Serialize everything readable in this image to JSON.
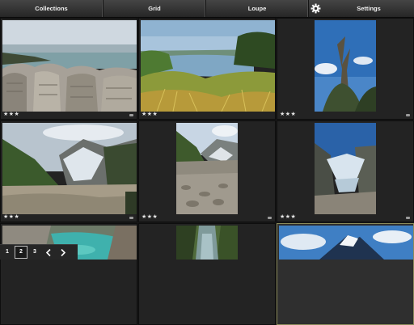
{
  "nav": {
    "collections": "Collections",
    "grid": "Grid",
    "loupe": "Loupe",
    "settings": "Settings",
    "settings_icon": "gear-icon"
  },
  "photos": [
    {
      "rating": "★★★",
      "subject": "limestone pancake rocks by the sea"
    },
    {
      "rating": "★★★",
      "subject": "lagoon with tussock grass"
    },
    {
      "rating": "★★★",
      "subject": "dead tree against blue sky"
    },
    {
      "rating": "★★★",
      "subject": "glacier valley with river bed"
    },
    {
      "rating": "★★★",
      "subject": "glacier and rocky river bed"
    },
    {
      "rating": "★★★",
      "subject": "glacier in mountain valley"
    },
    {
      "rating": "",
      "subject": "turquoise river gorge"
    },
    {
      "rating": "",
      "subject": "mountain stream through forest"
    },
    {
      "rating": "",
      "subject": "snow-capped mountain peak"
    }
  ],
  "pager": {
    "pages": [
      "1",
      "2",
      "3"
    ],
    "current": "2",
    "prev_icon": "chevron-left-icon",
    "next_icon": "chevron-right-icon"
  },
  "colors": {
    "background": "#161616",
    "cell": "#232323",
    "selected_cell": "#2f2f2f",
    "selected_border": "#8a8a5a",
    "text": "#f0f0f0"
  }
}
